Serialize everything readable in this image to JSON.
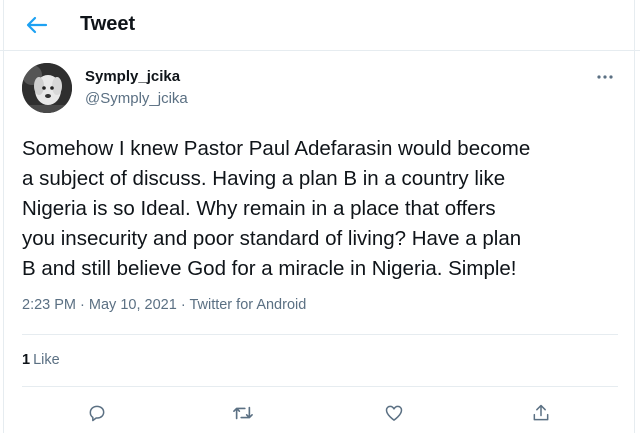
{
  "header": {
    "title": "Tweet",
    "back_icon": "back-arrow-icon",
    "accent_color": "#1da1f2"
  },
  "author": {
    "display_name": "Symply_jcika",
    "handle": "@Symply_jcika",
    "avatar_icon": "avatar-image"
  },
  "tweet": {
    "text": "Somehow I knew Pastor Paul Adefarasin would become\na subject of discuss. Having a plan B in a country like\nNigeria is so Ideal. Why remain in a place that offers\nyou insecurity and poor standard of living? Have a plan\nB and still believe God for a miracle in Nigeria. Simple!",
    "time": "2:23 PM",
    "date": "May 10, 2021",
    "source": "Twitter for Android",
    "separator": "·"
  },
  "stats": {
    "likes_count": "1",
    "likes_label": "Like"
  },
  "actions": {
    "more_icon": "more-options-icon",
    "reply_icon": "reply-icon",
    "retweet_icon": "retweet-icon",
    "like_icon": "heart-icon",
    "share_icon": "share-icon"
  },
  "colors": {
    "text": "#0f1419",
    "secondary": "#5b7083",
    "border": "#e6ecf0"
  }
}
